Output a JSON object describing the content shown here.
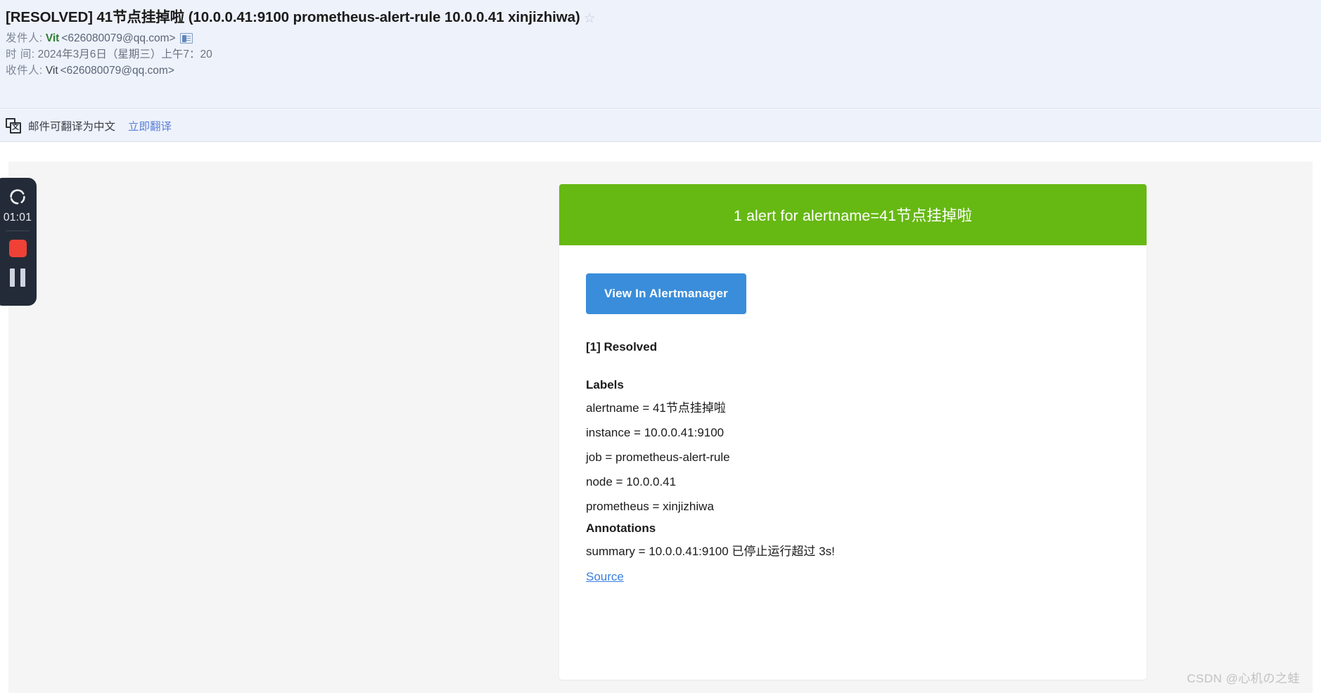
{
  "email": {
    "subject": "[RESOLVED] 41节点挂掉啦 (10.0.0.41:9100 prometheus-alert-rule 10.0.0.41 xinjizhiwa)",
    "star_icon": "star-outline-icon",
    "from_label": "发件人:",
    "from_name": "Vit",
    "from_address": "<626080079@qq.com>",
    "contact_icon": "contact-card-icon",
    "date_label": "时  间:",
    "date_value": "2024年3月6日（星期三）上午7：20",
    "to_label": "收件人:",
    "to_name": "Vit",
    "to_address": "<626080079@qq.com>"
  },
  "translate_bar": {
    "icon": "translate-icon",
    "icon_glyph": "文",
    "message": "邮件可翻译为中文",
    "action_label": "立即翻译"
  },
  "alert": {
    "banner_text": "1 alert for alertname=41节点挂掉啦",
    "banner_color": "#66b813",
    "button_label": "View In Alertmanager",
    "button_color": "#3a8dda",
    "status": "[1] Resolved",
    "labels_title": "Labels",
    "labels": [
      "alertname = 41节点挂掉啦",
      "instance = 10.0.0.41:9100",
      "job = prometheus-alert-rule",
      "node = 10.0.0.41",
      "prometheus = xinjizhiwa"
    ],
    "annotations_title": "Annotations",
    "annotations": [
      "summary = 10.0.0.41:9100 已停止运行超过 3s!"
    ],
    "source_label": "Source",
    "source_color": "#3a7fe0"
  },
  "recorder": {
    "logo_icon": "spinner-pinwheel-icon",
    "timer": "01:01",
    "stop_icon": "stop-square-icon",
    "stop_color": "#ef4136",
    "pause_icon": "pause-bars-icon"
  },
  "watermark": {
    "text": "CSDN @心机の之蛙"
  }
}
